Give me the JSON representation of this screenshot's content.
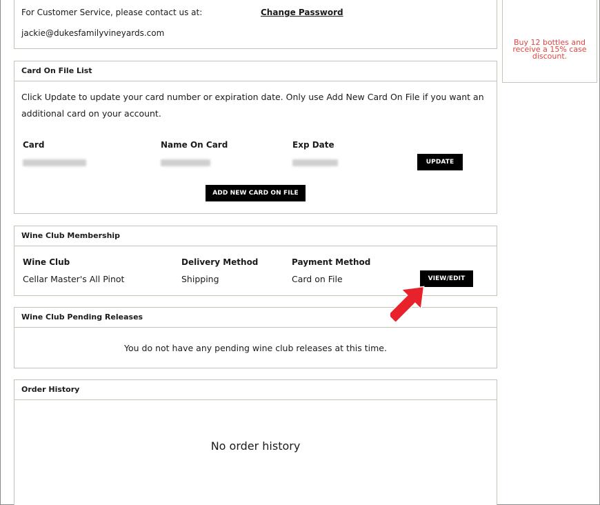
{
  "contact": {
    "service_text": "For Customer Service, please contact us at:",
    "change_password": "Change Password",
    "email": "jackie@dukesfamilyvineyards.com"
  },
  "promo": {
    "text": "Buy 12 bottles and receive a 15% case discount.",
    "color": "#e5413b"
  },
  "card_on_file": {
    "title": "Card On File List",
    "intro": "Click Update to update your card number or expiration date. Only use Add New Card On File if you want an additional card on your account.",
    "columns": [
      "Card",
      "Name On Card",
      "Exp Date"
    ],
    "update_label": "UPDATE",
    "add_new_label": "ADD NEW CARD ON FILE"
  },
  "wine_club": {
    "title": "Wine Club Membership",
    "columns": [
      "Wine Club",
      "Delivery Method",
      "Payment Method"
    ],
    "row": [
      "Cellar Master's All Pinot",
      "Shipping",
      "Card on File"
    ],
    "view_edit_label": "VIEW/EDIT"
  },
  "pending": {
    "title": "Wine Club Pending Releases",
    "message": "You do not have any pending wine club releases at this time."
  },
  "orders": {
    "title": "Order History",
    "message": "No order history"
  },
  "annotation": {
    "arrow_color": "#e8222a"
  }
}
